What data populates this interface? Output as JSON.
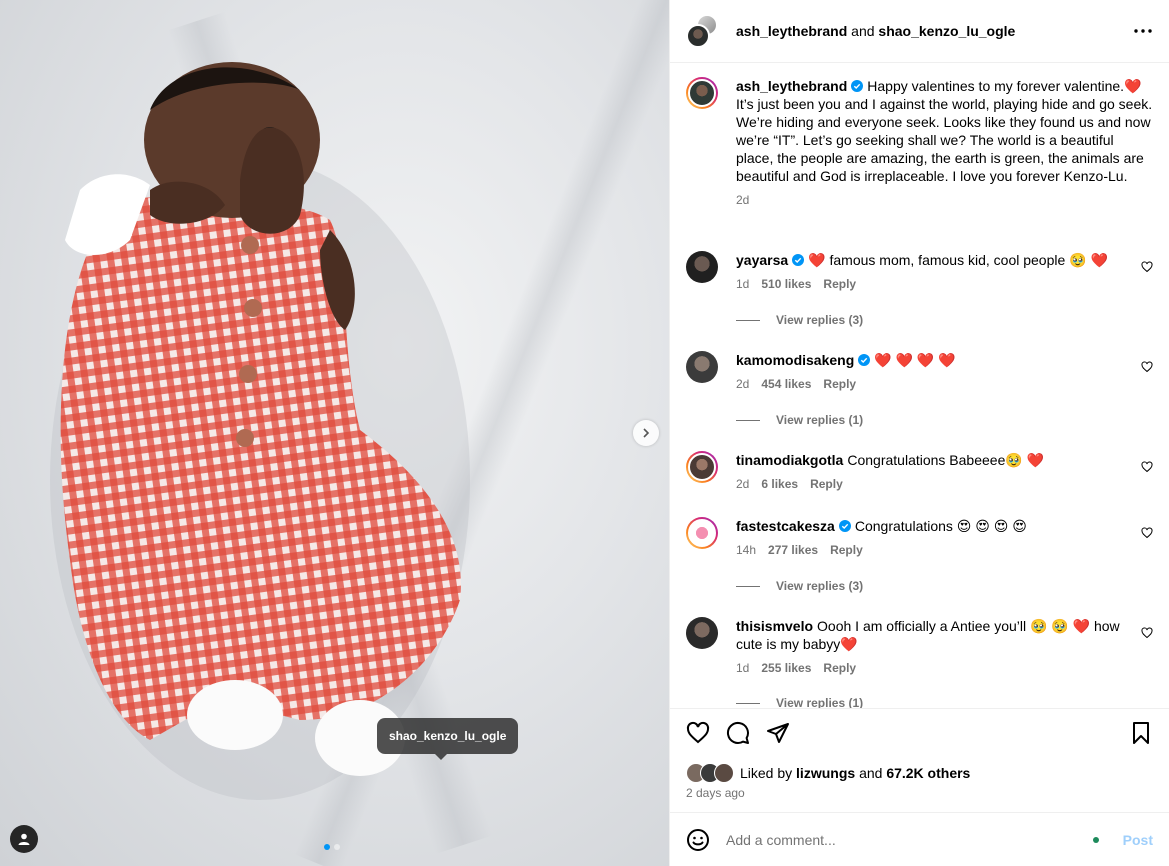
{
  "post": {
    "header": {
      "author": "ash_leythebrand",
      "connector": "and",
      "collaborator": "shao_kenzo_lu_ogle"
    },
    "caption": {
      "username": "ash_leythebrand",
      "text": "Happy valentines to my forever valentine.❤️ It’s just been you and I against the world, playing hide and go seek. We’re hiding and everyone seek. Looks like they found us and now we’re “IT”. Let’s go seeking shall we? The world is a beautiful place, the people are amazing, the earth is green, the animals are beautiful and God is irreplaceable. I love you forever Kenzo-Lu.",
      "time": "2d"
    },
    "media": {
      "tag_label": "shao_kenzo_lu_ogle",
      "slide_count": 2,
      "active_slide": 1
    },
    "comments": [
      {
        "username": "yayarsa",
        "verified": true,
        "text": "❤️ famous mom, famous kid, cool people 🥹 ❤️",
        "time": "1d",
        "likes": "510 likes",
        "reply": "Reply",
        "view_replies": "View replies (3)"
      },
      {
        "username": "kamomodisakeng",
        "verified": true,
        "text": "❤️ ❤️ ❤️ ❤️",
        "time": "2d",
        "likes": "454 likes",
        "reply": "Reply",
        "view_replies": "View replies (1)"
      },
      {
        "username": "tinamodiakgotla",
        "verified": false,
        "text": "Congratulations Babeeee🥹 ❤️",
        "time": "2d",
        "likes": "6 likes",
        "reply": "Reply"
      },
      {
        "username": "fastestcakesza",
        "verified": true,
        "text": "Congratulations 😍 😍 😍 😍",
        "time": "14h",
        "likes": "277 likes",
        "reply": "Reply",
        "view_replies": "View replies (3)"
      },
      {
        "username": "thisismvelo",
        "verified": false,
        "text": "Oooh I am officially a Antiee you’ll 🥹 🥹 ❤️ how cute is my babyy❤️",
        "time": "1d",
        "likes": "255 likes",
        "reply": "Reply",
        "view_replies": "View replies (1)"
      }
    ],
    "likes": {
      "prefix": "Liked by",
      "user": "lizwungs",
      "connector": "and",
      "others": "67.2K others"
    },
    "posted": "2 days ago",
    "composer": {
      "placeholder": "Add a comment...",
      "post_label": "Post"
    },
    "colors": {
      "verified": "#0095f6",
      "heart": "#e0245e",
      "post_disabled": "#9fcffb"
    }
  }
}
